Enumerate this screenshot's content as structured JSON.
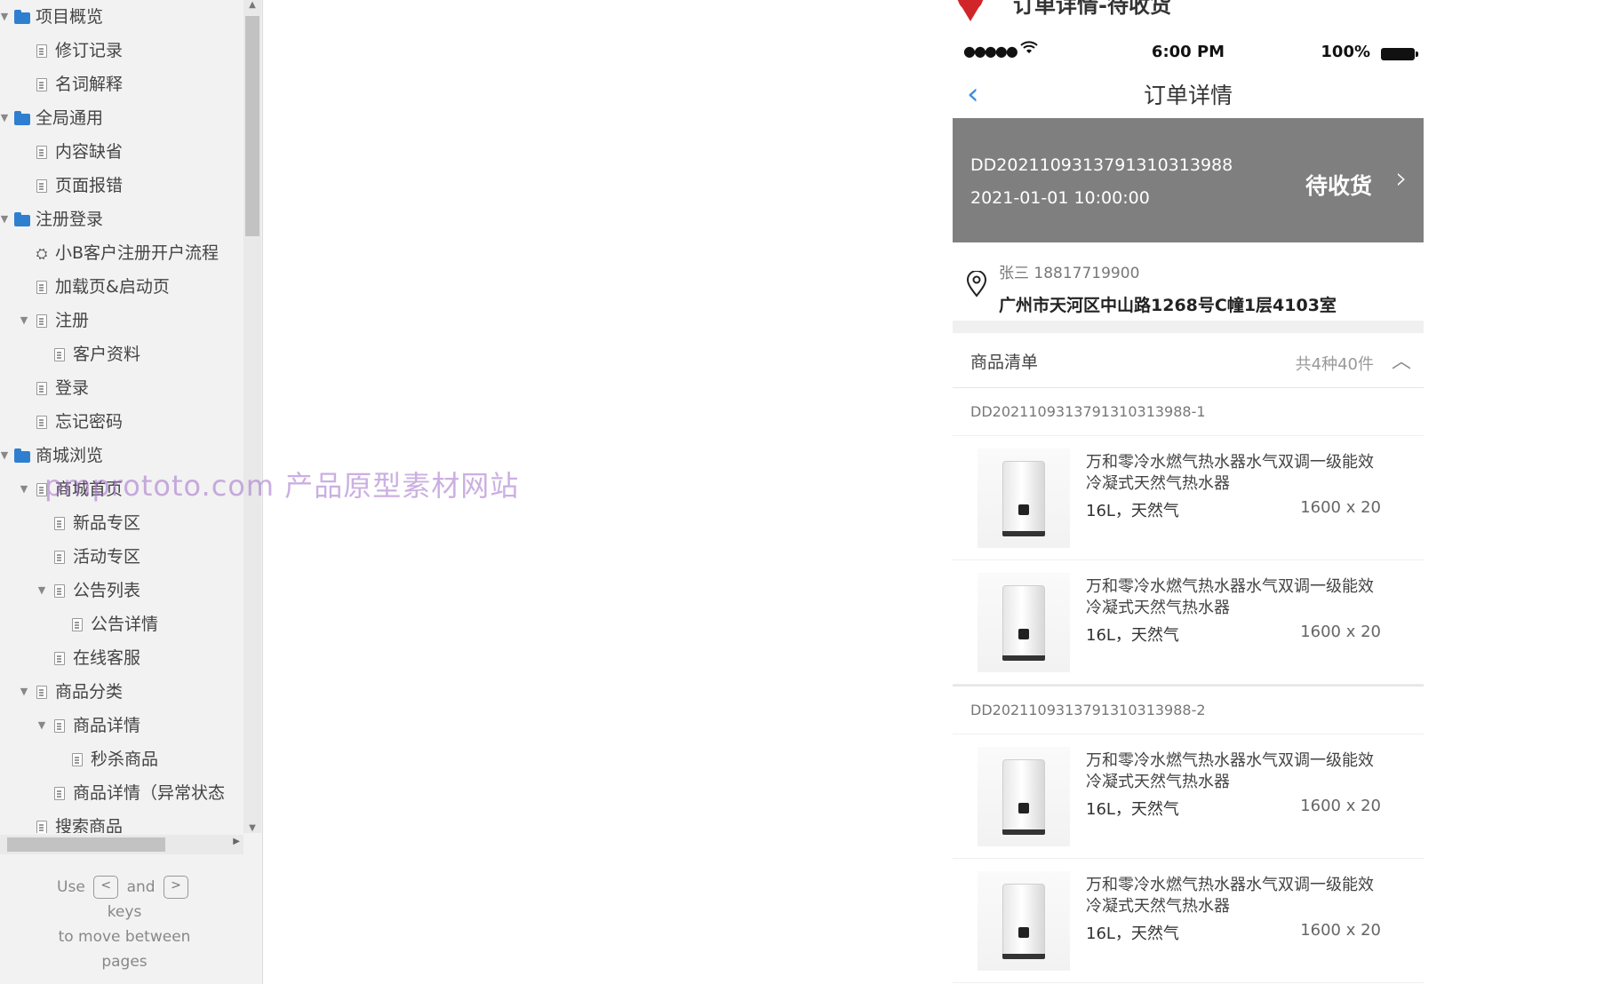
{
  "sidebar": {
    "items": [
      {
        "label": "项目概览",
        "level": 0,
        "type": "folder",
        "expanded": true
      },
      {
        "label": "修订记录",
        "level": 1,
        "type": "page"
      },
      {
        "label": "名词解释",
        "level": 1,
        "type": "page"
      },
      {
        "label": "全局通用",
        "level": 0,
        "type": "folder",
        "expanded": true
      },
      {
        "label": "内容缺省",
        "level": 1,
        "type": "page"
      },
      {
        "label": "页面报错",
        "level": 1,
        "type": "page"
      },
      {
        "label": "注册登录",
        "level": 0,
        "type": "folder",
        "expanded": true
      },
      {
        "label": "小B客户注册开户流程",
        "level": 1,
        "type": "flow"
      },
      {
        "label": "加载页&启动页",
        "level": 1,
        "type": "page"
      },
      {
        "label": "注册",
        "level": 1,
        "type": "page",
        "expanded": true
      },
      {
        "label": "客户资料",
        "level": 2,
        "type": "page"
      },
      {
        "label": "登录",
        "level": 1,
        "type": "page"
      },
      {
        "label": "忘记密码",
        "level": 1,
        "type": "page"
      },
      {
        "label": "商城浏览",
        "level": 0,
        "type": "folder",
        "expanded": true
      },
      {
        "label": "商城首页",
        "level": 1,
        "type": "page",
        "expanded": true
      },
      {
        "label": "新品专区",
        "level": 2,
        "type": "page"
      },
      {
        "label": "活动专区",
        "level": 2,
        "type": "page"
      },
      {
        "label": "公告列表",
        "level": 2,
        "type": "page",
        "expanded": true
      },
      {
        "label": "公告详情",
        "level": 3,
        "type": "page"
      },
      {
        "label": "在线客服",
        "level": 2,
        "type": "page"
      },
      {
        "label": "商品分类",
        "level": 1,
        "type": "page",
        "expanded": true
      },
      {
        "label": "商品详情",
        "level": 2,
        "type": "page",
        "expanded": true
      },
      {
        "label": "秒杀商品",
        "level": 3,
        "type": "page"
      },
      {
        "label": "商品详情（异常状态",
        "level": 2,
        "type": "page"
      },
      {
        "label": "搜索商品",
        "level": 1,
        "type": "page"
      }
    ],
    "hint": {
      "use": "Use",
      "and": "and",
      "keys": "keys",
      "line2": "to move between",
      "line3": "pages",
      "prev_key": "<",
      "next_key": ">"
    }
  },
  "watermark": "pmprototo.com 产品原型素材网站",
  "page": {
    "title": "订单详情-待收货"
  },
  "statusbar": {
    "signal": "●●●●●",
    "time": "6:00 PM",
    "battery": "100%"
  },
  "navbar": {
    "title": "订单详情"
  },
  "order": {
    "number": "DD2021109313791310313988",
    "time": "2021-01-01 10:00:00",
    "status": "待收货"
  },
  "address": {
    "name_phone": "张三  18817719900",
    "detail": "广州市天河区中山路1268号C幢1层4103室"
  },
  "goods": {
    "label": "商品清单",
    "count": "共4种40件",
    "groups": [
      {
        "no": "DD2021109313791310313988-1",
        "items": [
          {
            "name": "万和零冷水燃气热水器水气双调一级能效冷凝式天然气热水器",
            "spec": "16L，天然气",
            "price": "1600 x 20"
          },
          {
            "name": "万和零冷水燃气热水器水气双调一级能效冷凝式天然气热水器",
            "spec": "16L，天然气",
            "price": "1600 x 20"
          }
        ]
      },
      {
        "no": "DD2021109313791310313988-2",
        "items": [
          {
            "name": "万和零冷水燃气热水器水气双调一级能效冷凝式天然气热水器",
            "spec": "16L，天然气",
            "price": "1600 x 20"
          },
          {
            "name": "万和零冷水燃气热水器水气双调一级能效冷凝式天然气热水器",
            "spec": "16L，天然气",
            "price": "1600 x 20"
          }
        ]
      }
    ]
  },
  "colors": {
    "accent": "#3b8fd8",
    "banner": "#7f7f7f",
    "marker": "#d0262a"
  }
}
